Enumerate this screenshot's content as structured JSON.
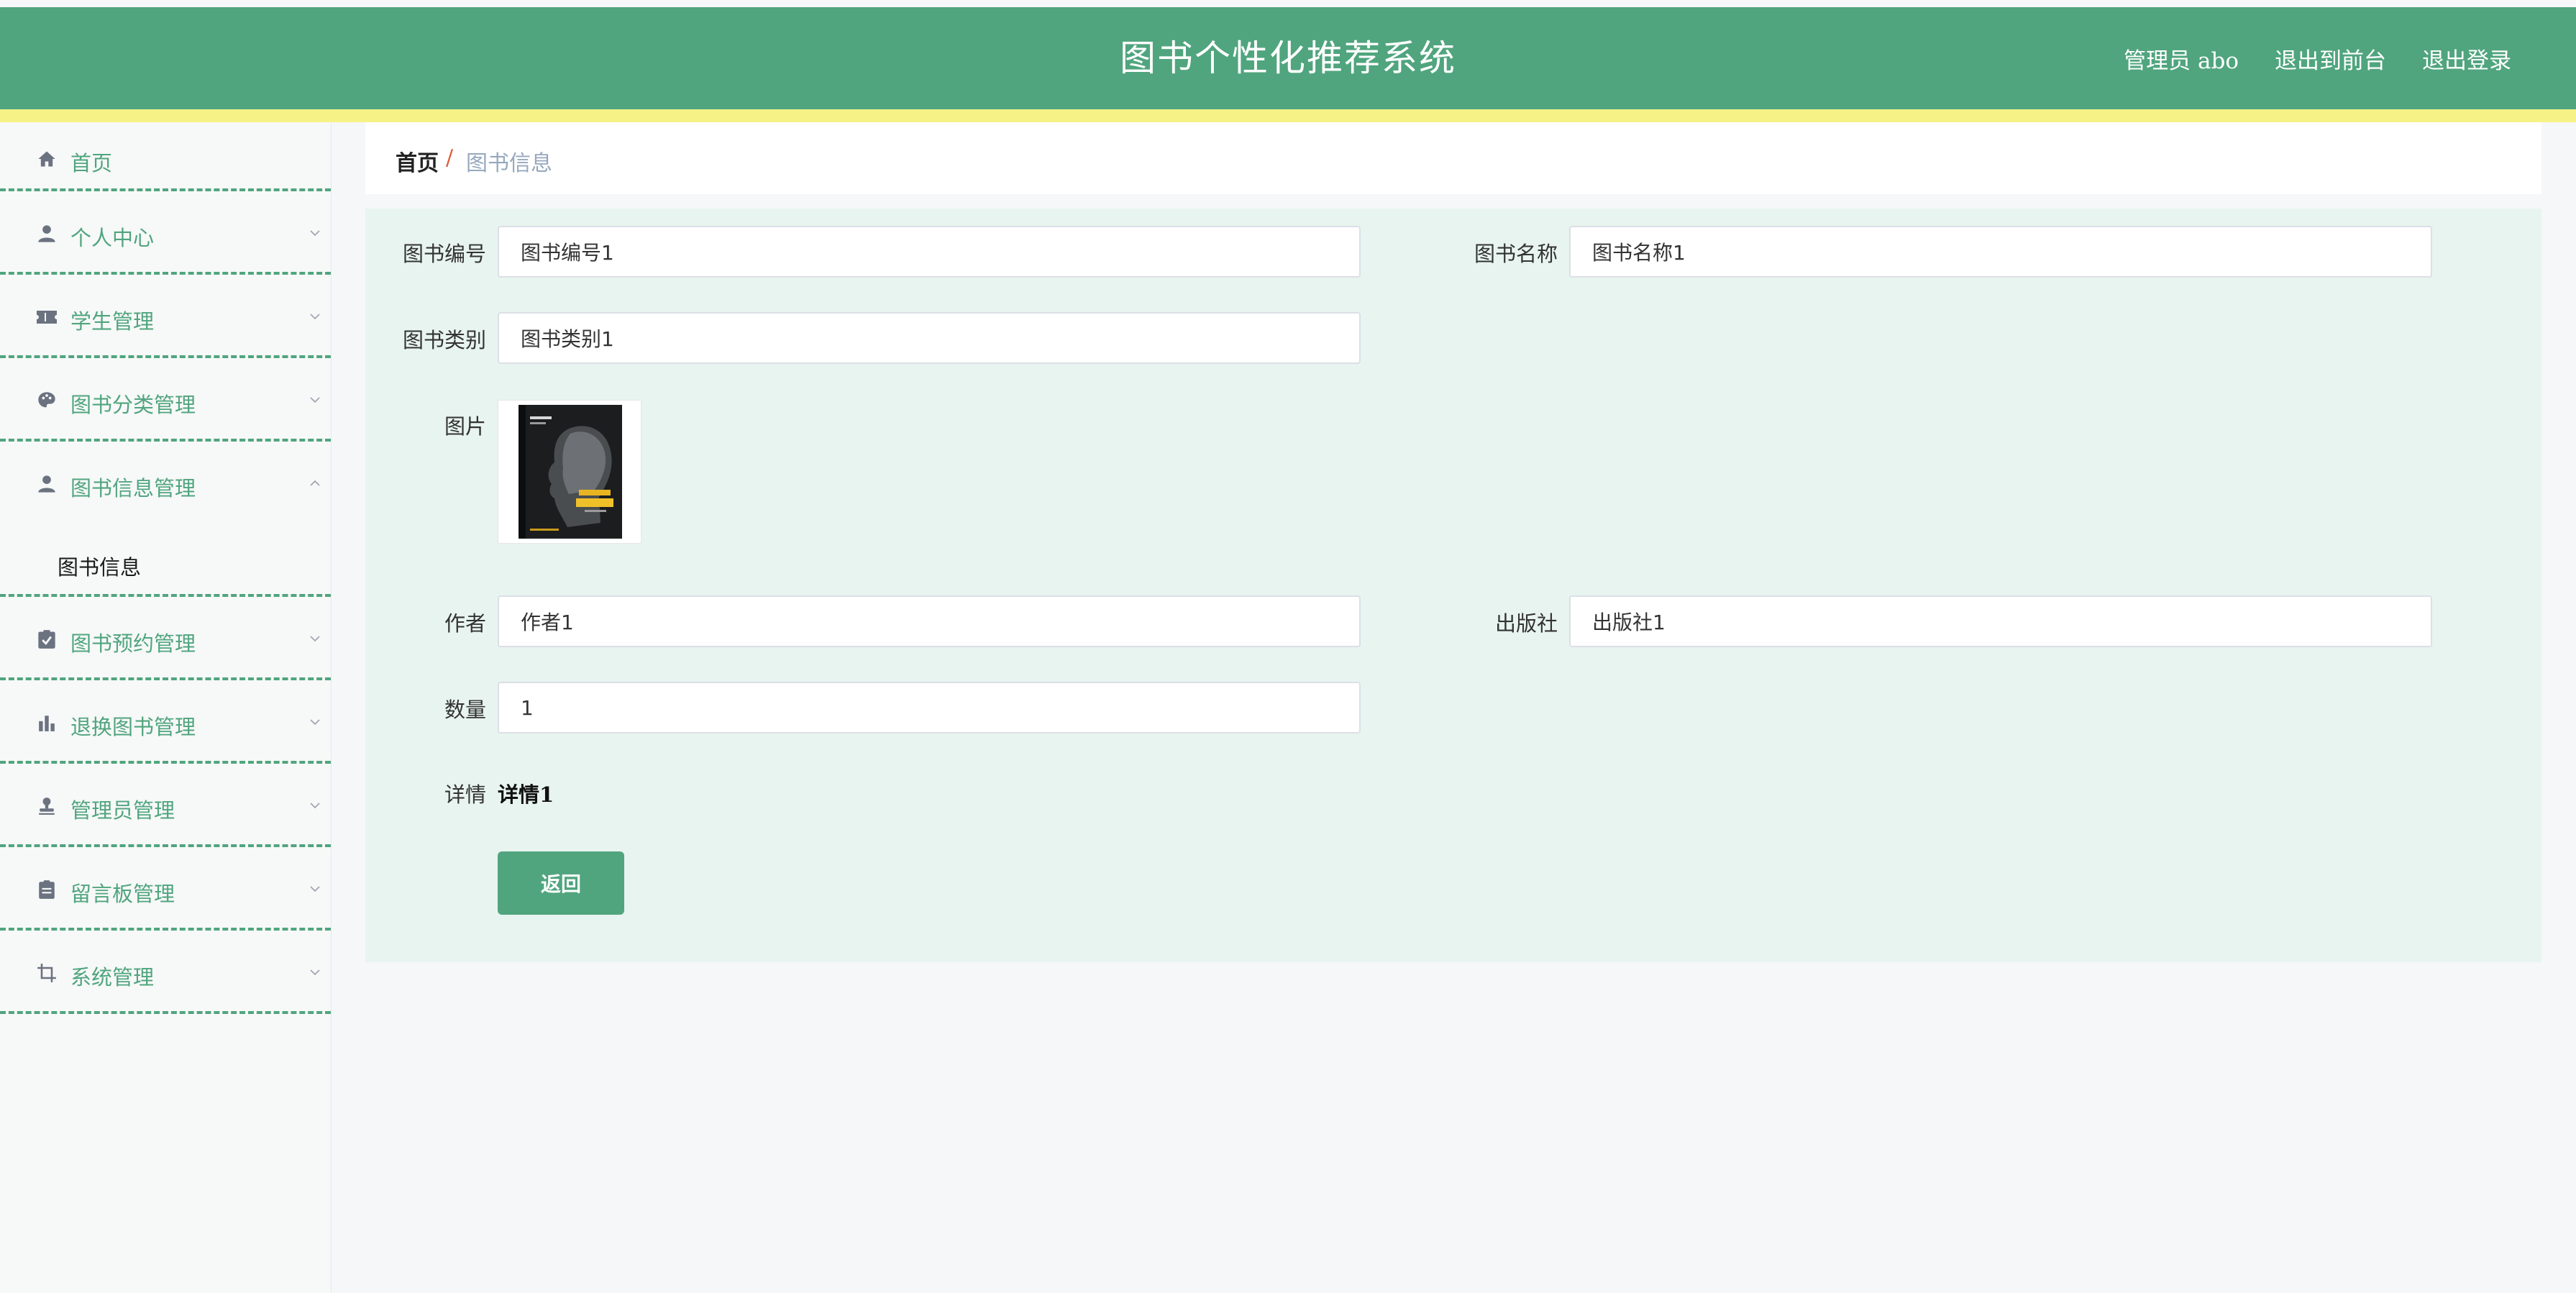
{
  "header": {
    "title": "图书个性化推荐系统",
    "user_label": "管理员 abo",
    "back_to_front": "退出到前台",
    "logout": "退出登录"
  },
  "colors": {
    "primary": "#50a57e",
    "accent_bar": "#f7f286",
    "panel_bg": "#e8f4ef"
  },
  "sidebar": {
    "items": [
      {
        "label": "首页",
        "icon": "home-icon"
      },
      {
        "label": "个人中心",
        "icon": "user-icon"
      },
      {
        "label": "学生管理",
        "icon": "ticket-icon"
      },
      {
        "label": "图书分类管理",
        "icon": "palette-icon"
      },
      {
        "label": "图书信息管理",
        "icon": "person-icon",
        "expanded": true
      },
      {
        "label": "图书预约管理",
        "icon": "clipboard-check-icon"
      },
      {
        "label": "退换图书管理",
        "icon": "bar-chart-icon"
      },
      {
        "label": "管理员管理",
        "icon": "stamp-icon"
      },
      {
        "label": "留言板管理",
        "icon": "clipboard-icon"
      },
      {
        "label": "系统管理",
        "icon": "crop-icon"
      }
    ],
    "submenu": {
      "label": "图书信息"
    }
  },
  "breadcrumb": {
    "home": "首页",
    "separator": "/",
    "current": "图书信息"
  },
  "form": {
    "book_no": {
      "label": "图书编号",
      "value": "图书编号1"
    },
    "book_name": {
      "label": "图书名称",
      "value": "图书名称1"
    },
    "category": {
      "label": "图书类别",
      "value": "图书类别1"
    },
    "image": {
      "label": "图片"
    },
    "author": {
      "label": "作者",
      "value": "作者1"
    },
    "publisher": {
      "label": "出版社",
      "value": "出版社1"
    },
    "quantity": {
      "label": "数量",
      "value": "1"
    },
    "detail": {
      "label": "详情",
      "value": "详情1"
    },
    "back_button": "返回"
  }
}
